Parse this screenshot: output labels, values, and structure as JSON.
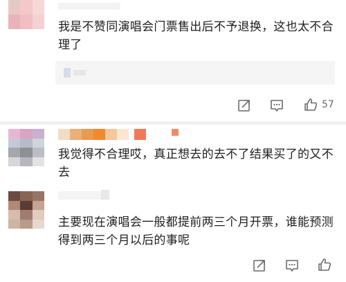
{
  "comments": [
    {
      "text": "我是不赞同演唱会门票售出后不予退换，这也太不合理了",
      "like_count": "57",
      "icons": [
        "share-icon",
        "comment-icon",
        "like-icon"
      ]
    },
    {
      "text": "我觉得不合理哎，真正想去的去不了结果买了的又不去"
    },
    {
      "text": "主要现在演唱会一般都提前两三个月开票，谁能预测得到两三个月以后的事呢",
      "icons": [
        "share-icon",
        "comment-icon",
        "like-icon"
      ]
    }
  ],
  "colors": {
    "divider": "#f1f1f1",
    "text": "#1e1e1e",
    "icon": "#6a6a6a"
  }
}
